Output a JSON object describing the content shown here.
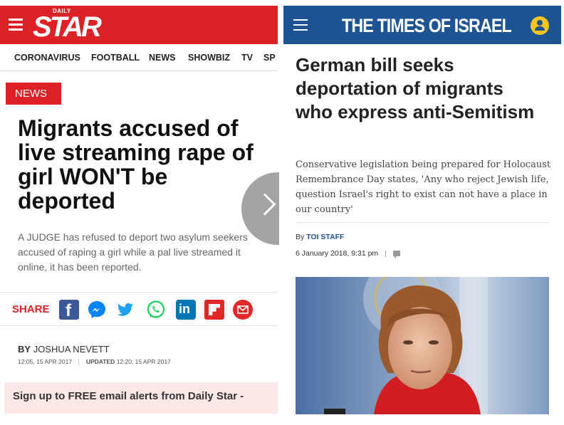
{
  "daily_star": {
    "logo_small": "DAILY",
    "logo_main": "STAR",
    "nav_items": [
      "CORONAVIRUS",
      "FOOTBALL",
      "NEWS",
      "SHOWBIZ",
      "TV",
      "SP"
    ],
    "section_tag": "NEWS",
    "headline": "Migrants accused of live streaming rape of girl WON'T be deported",
    "standfirst": "A JUDGE has refused to deport two asylum seekers accused of raping a girl while a pal live streamed it online, it has been reported.",
    "share_label": "SHARE",
    "byline_prefix": "BY",
    "author": "JOSHUA NEVETT",
    "published": "12:05, 15 APR 2017",
    "updated_label": "UPDATED",
    "updated": "12:20, 15 APR 2017",
    "alert_text": "Sign up to FREE email alerts from Daily Star -",
    "colors": {
      "brand_red": "#dc2127"
    }
  },
  "times_of_israel": {
    "title": "THE TIMES OF ISRAEL",
    "headline": "German bill seeks deportation of migrants who express anti-Semitism",
    "excerpt": "Conservative legislation being prepared for Holocaust Remembrance Day states, 'Any who reject Jewish life, question Israel's right to exist can not have a place in our country'",
    "author_prefix": "By",
    "author": "TOI STAFF",
    "date": "6 January 2018, 9:31 pm",
    "date_separator": "|",
    "colors": {
      "brand_blue": "#1e5494",
      "user_icon": "#f7c61c"
    }
  }
}
